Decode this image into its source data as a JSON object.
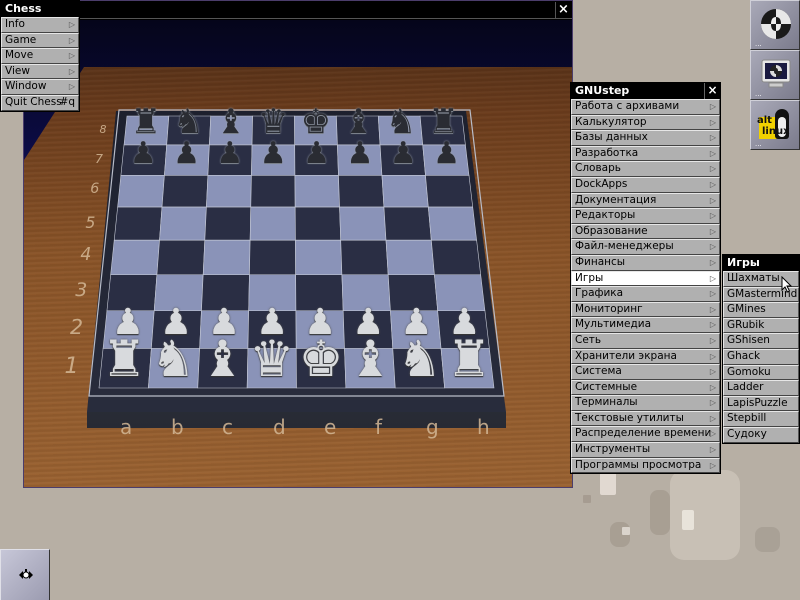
{
  "chess_window": {
    "title": "",
    "close_icon": "×",
    "rank_labels": [
      "8",
      "7",
      "6",
      "5",
      "4",
      "3",
      "2",
      "1"
    ],
    "file_labels": [
      "a",
      "b",
      "c",
      "d",
      "e",
      "f",
      "g",
      "h"
    ],
    "black_back_rank": [
      "♜",
      "♞",
      "♝",
      "♛",
      "♚",
      "♝",
      "♞",
      "♜"
    ],
    "black_pawns": [
      "♟",
      "♟",
      "♟",
      "♟",
      "♟",
      "♟",
      "♟",
      "♟"
    ],
    "white_pawns": [
      "♟",
      "♟",
      "♟",
      "♟",
      "♟",
      "♟",
      "♟",
      "♟"
    ],
    "white_back_rank": [
      "♜",
      "♞",
      "♝",
      "♛",
      "♚",
      "♝",
      "♞",
      "♜"
    ],
    "colors": {
      "light_square": "#8a93b8",
      "dark_square": "#2a2e44",
      "wood": "#8a5428",
      "label": "#d4b896"
    }
  },
  "chess_menu": {
    "title": "Chess",
    "items": [
      {
        "label": "Info",
        "submenu": true
      },
      {
        "label": "Game",
        "submenu": true
      },
      {
        "label": "Move",
        "submenu": true
      },
      {
        "label": "View",
        "submenu": true
      },
      {
        "label": "Window",
        "submenu": true
      },
      {
        "label": "Quit Chess",
        "shortcut": "#q"
      }
    ]
  },
  "gnustep_menu": {
    "title": "GNUstep",
    "close_icon": "×",
    "items": [
      {
        "label": "Работа с архивами"
      },
      {
        "label": "Калькулятор"
      },
      {
        "label": "Базы данных"
      },
      {
        "label": "Разработка"
      },
      {
        "label": "Словарь"
      },
      {
        "label": "DockApps"
      },
      {
        "label": "Документация"
      },
      {
        "label": "Редакторы"
      },
      {
        "label": "Образование"
      },
      {
        "label": "Файл-менеджеры"
      },
      {
        "label": "Финансы"
      },
      {
        "label": "Игры",
        "selected": true
      },
      {
        "label": "Графика"
      },
      {
        "label": "Мониторинг"
      },
      {
        "label": "Мультимедиа"
      },
      {
        "label": "Сеть"
      },
      {
        "label": "Хранители экрана"
      },
      {
        "label": "Система"
      },
      {
        "label": "Системные"
      },
      {
        "label": "Терминалы"
      },
      {
        "label": "Текстовые утилиты"
      },
      {
        "label": "Распределение времени"
      },
      {
        "label": "Инструменты"
      },
      {
        "label": "Программы просмотра"
      }
    ],
    "arrow_glyph": "▷"
  },
  "games_menu": {
    "title": "Игры",
    "items": [
      {
        "label": "Шахматы"
      },
      {
        "label": "GMastermind"
      },
      {
        "label": "GMines"
      },
      {
        "label": "GRubik"
      },
      {
        "label": "GShisen"
      },
      {
        "label": "Ghack"
      },
      {
        "label": "Gomoku"
      },
      {
        "label": "Ladder"
      },
      {
        "label": "LapisPuzzle"
      },
      {
        "label": "Stepbill"
      },
      {
        "label": "Судоку"
      }
    ]
  },
  "dock": {
    "tiles": [
      {
        "name": "gnustep-icon",
        "dots": "..."
      },
      {
        "name": "monitor-icon",
        "dots": "..."
      },
      {
        "name": "altlinux-icon",
        "dots": "...",
        "text_top": "alt",
        "text_bottom": "linux"
      }
    ]
  },
  "clip": {
    "name": "clip-icon"
  }
}
